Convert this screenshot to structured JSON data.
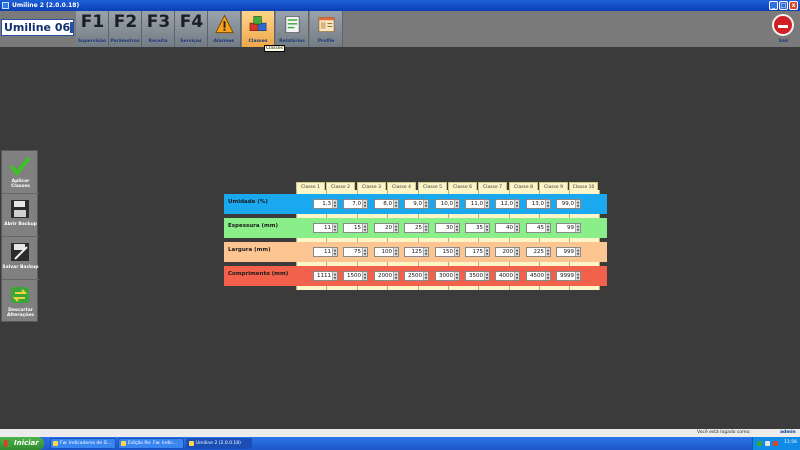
{
  "window": {
    "title": "Umiline 2 (2.0.0.18)",
    "minimize_glyph": "_",
    "maximize_glyph": "□",
    "close_glyph": "x"
  },
  "brand": "Umiline 06",
  "toolbar": {
    "fkeys": [
      {
        "key": "F1",
        "label": "Supervisão"
      },
      {
        "key": "F2",
        "label": "Parâmetros"
      },
      {
        "key": "F3",
        "label": "Receita"
      },
      {
        "key": "F4",
        "label": "Serviços"
      }
    ],
    "icon_buttons": [
      {
        "label": "Alarmes",
        "icon": "warning-icon"
      },
      {
        "label": "Classes",
        "icon": "cubes-icon"
      },
      {
        "label": "Relatórios",
        "icon": "report-icon"
      },
      {
        "label": "Profile",
        "icon": "profile-icon"
      }
    ],
    "tooltip": "Classes",
    "exit_label": "Sair"
  },
  "side_actions": [
    {
      "label": "Aplicar Classes",
      "icon": "checkmark-icon"
    },
    {
      "label": "Abrir Backup",
      "icon": "floppy-disk-icon"
    },
    {
      "label": "Salvar Backup",
      "icon": "save-disk-icon"
    },
    {
      "label": "Descartar Alterações",
      "icon": "refresh-arrows-icon"
    }
  ],
  "classes_table": {
    "columns": [
      "Classe 1",
      "Classe 2",
      "Classe 3",
      "Classe 4",
      "Classe 5",
      "Classe 6",
      "Classe 7",
      "Classe 8",
      "Classe 9",
      "Classe 10"
    ],
    "rows": [
      {
        "label": "Umidade (%)",
        "color": "#1aa9ee",
        "values": [
          "1,3",
          "7,0",
          "8,0",
          "9,0",
          "10,0",
          "11,0",
          "12,0",
          "13,0",
          "99,0"
        ]
      },
      {
        "label": "Espessura (mm)",
        "color": "#8bef89",
        "values": [
          "11",
          "15",
          "20",
          "25",
          "30",
          "35",
          "40",
          "45",
          "99"
        ]
      },
      {
        "label": "Largura (mm)",
        "color": "#fcc591",
        "values": [
          "11",
          "75",
          "100",
          "125",
          "150",
          "175",
          "200",
          "225",
          "999"
        ]
      },
      {
        "label": "Comprimento (mm)",
        "color": "#f2614b",
        "values": [
          "1111",
          "1500",
          "2000",
          "2500",
          "3000",
          "3500",
          "4000",
          "4500",
          "9999"
        ]
      }
    ]
  },
  "status": {
    "logged_in_text": "Você está logado como:",
    "user": "admin"
  },
  "taskbar": {
    "start": "Iniciar",
    "tasks": [
      "Fw: Indicadores de D...",
      "Edição Re: Fw: Indic...",
      "Umiline 2 (2.0.0.18)"
    ],
    "clock": "11:56"
  }
}
